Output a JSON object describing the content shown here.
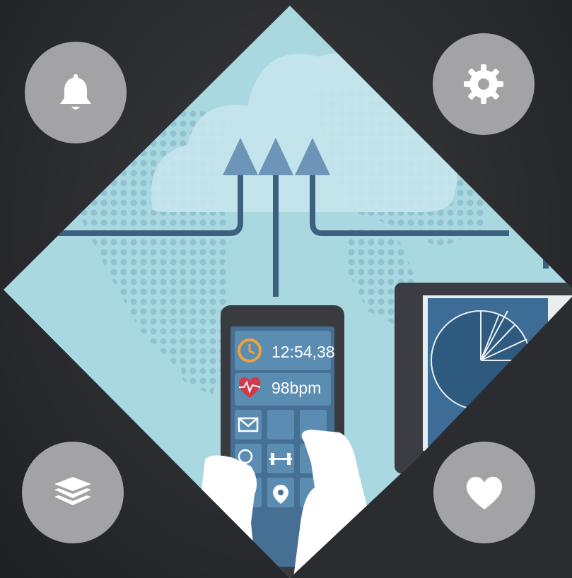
{
  "illustration": {
    "time_readout": "12:54,38",
    "heart_rate_readout": "98bpm"
  },
  "colors": {
    "background": "#2b2c30",
    "panel": "#9fd0da",
    "phone_screen": "#3f6d92",
    "button": "#a3a3a5"
  },
  "corner_buttons": [
    {
      "icon": "bell-icon"
    },
    {
      "icon": "gear-icon"
    },
    {
      "icon": "layers-icon"
    },
    {
      "icon": "heart-icon"
    }
  ]
}
